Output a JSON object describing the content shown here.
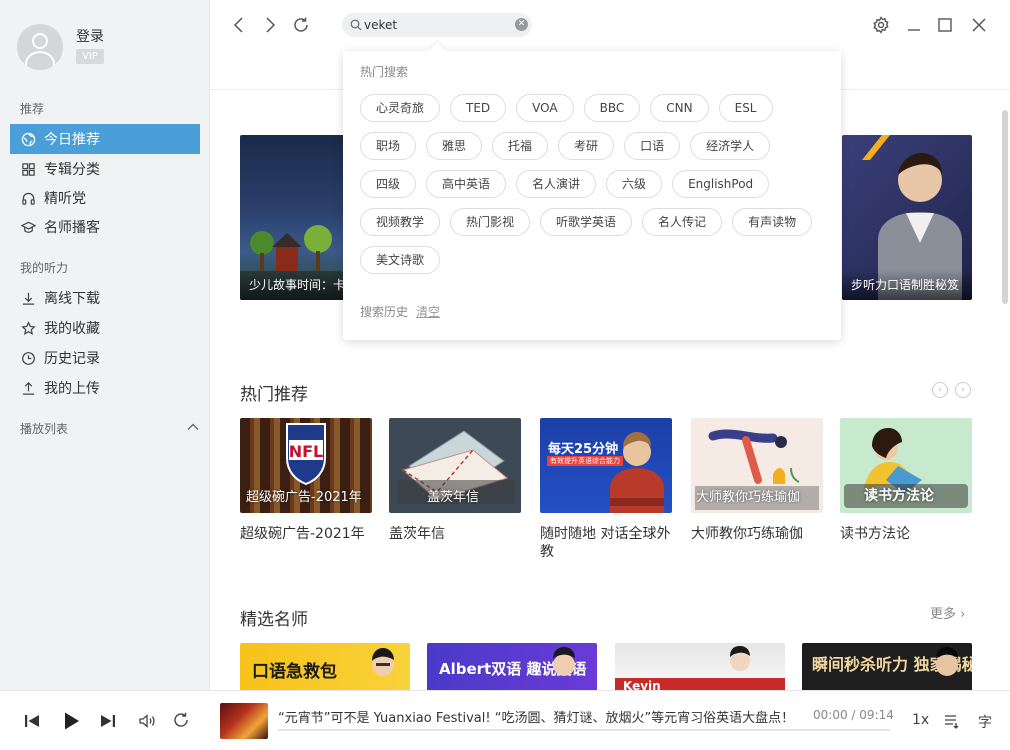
{
  "user": {
    "login_label": "登录",
    "vip_label": "VIP"
  },
  "sidebar": {
    "section_recommend": "推荐",
    "recommend_items": [
      {
        "label": "今日推荐",
        "icon": "compass-icon"
      },
      {
        "label": "专辑分类",
        "icon": "grid-icon"
      },
      {
        "label": "精听党",
        "icon": "headphones-icon"
      },
      {
        "label": "名师播客",
        "icon": "graduation-cap-icon"
      }
    ],
    "section_my": "我的听力",
    "my_items": [
      {
        "label": "离线下载",
        "icon": "download-icon"
      },
      {
        "label": "我的收藏",
        "icon": "star-icon"
      },
      {
        "label": "历史记录",
        "icon": "clock-icon"
      },
      {
        "label": "我的上传",
        "icon": "upload-icon"
      }
    ],
    "section_playlist": "播放列表"
  },
  "search": {
    "value": "veket",
    "placeholder": ""
  },
  "dropdown": {
    "hot_title": "热门搜索",
    "hot_tags": [
      "心灵奇旅",
      "TED",
      "VOA",
      "BBC",
      "CNN",
      "ESL",
      "职场",
      "雅思",
      "托福",
      "考研",
      "口语",
      "经济学人",
      "四级",
      "高中英语",
      "名人演讲",
      "六级",
      "EnglishPod",
      "视频教学",
      "热门影视",
      "听歌学英语",
      "名人传记",
      "有声读物",
      "美文诗歌"
    ],
    "history_label": "搜索历史",
    "clear_label": "清空"
  },
  "banners": [
    {
      "caption": "少儿故事时间：卡"
    },
    {
      "caption": "步听力口语制胜秘笈"
    }
  ],
  "hot": {
    "title": "热门推荐",
    "cards": [
      {
        "overlay": "超级碗广告-2021年",
        "title": "超级碗广告-2021年"
      },
      {
        "overlay": "盖茨年信",
        "title": "盖茨年信"
      },
      {
        "overlay": "每天25分钟",
        "overlay_sub": "有效提升英语综合能力",
        "title": "随时随地 对话全球外教"
      },
      {
        "overlay": "大师教你巧练瑜伽",
        "title": "大师教你巧练瑜伽"
      },
      {
        "overlay": "读书方法论",
        "title": "读书方法论"
      }
    ]
  },
  "teachers": {
    "title": "精选名师",
    "more": "更多",
    "items": [
      {
        "text": "口语急救包"
      },
      {
        "text": "Albert双语  趣说英语"
      },
      {
        "text": "Kevin"
      },
      {
        "text": "瞬间秒杀听力  独家揭秘"
      }
    ]
  },
  "player": {
    "title": "“元宵节”可不是 Yuanxiao Festival! “吃汤圆、猜灯谜、放烟火”等元宵习俗英语大盘点！",
    "current": "00:00",
    "separator": "/",
    "duration": "09:14",
    "speed": "1x",
    "lyrics": "字"
  }
}
